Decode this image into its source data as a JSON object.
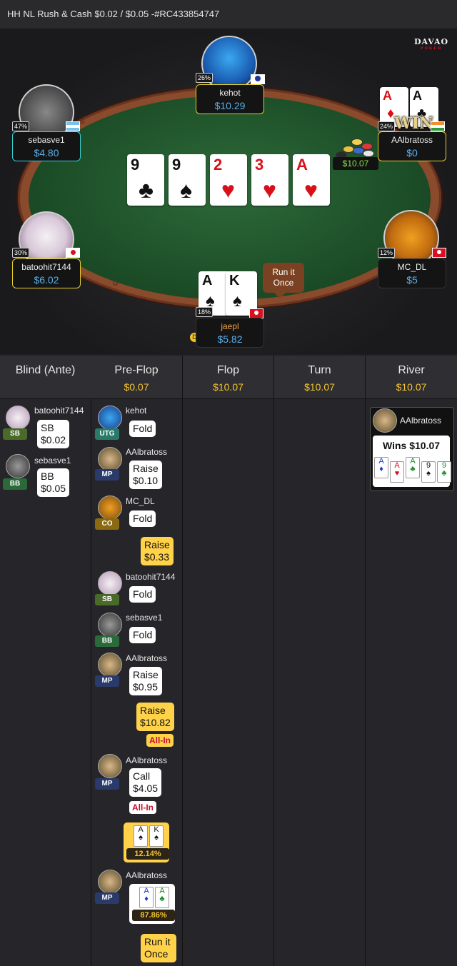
{
  "title": "HH NL Rush & Cash $0.02 / $0.05 -#RC433854747",
  "logo": {
    "brand": "DAVAO",
    "sub": "POKER"
  },
  "board": [
    {
      "rank": "9",
      "suit": "♣",
      "color": "#111111"
    },
    {
      "rank": "9",
      "suit": "♠",
      "color": "#111111"
    },
    {
      "rank": "2",
      "suit": "♥",
      "color": "#d8101a"
    },
    {
      "rank": "3",
      "suit": "♥",
      "color": "#d8101a"
    },
    {
      "rank": "A",
      "suit": "♥",
      "color": "#d8101a"
    }
  ],
  "pot": "$10.07",
  "win_label": "WIN",
  "run_it": "Run it Once",
  "dealer_label": "D",
  "players": {
    "kehot": {
      "name": "kehot",
      "stack": "$10.29",
      "equity": "26%"
    },
    "sebasve1": {
      "name": "sebasve1",
      "stack": "$4.80",
      "equity": "47%"
    },
    "aalbratoss": {
      "name": "AAlbratoss",
      "stack": "$0",
      "equity": "24%",
      "cards": [
        "A♦",
        "A♣"
      ]
    },
    "batoohit7144": {
      "name": "batoohit7144",
      "stack": "$6.02",
      "equity": "30%"
    },
    "mc_dl": {
      "name": "MC_DL",
      "stack": "$5",
      "equity": "12%"
    },
    "jaepl": {
      "name": "jaepl",
      "stack": "$5.82",
      "equity": "18%",
      "cards": [
        "A♠",
        "K♠"
      ]
    }
  },
  "history": {
    "columns": [
      {
        "label": "Blind (Ante)",
        "value": ""
      },
      {
        "label": "Pre-Flop",
        "value": "$0.07"
      },
      {
        "label": "Flop",
        "value": "$10.07"
      },
      {
        "label": "Turn",
        "value": "$10.07"
      },
      {
        "label": "River",
        "value": "$10.07"
      }
    ],
    "blinds": [
      {
        "name": "batoohit7144",
        "pos": "SB",
        "action": "SB",
        "amount": "$0.02"
      },
      {
        "name": "sebasve1",
        "pos": "BB",
        "action": "BB",
        "amount": "$0.05"
      }
    ],
    "preflop": [
      {
        "name": "kehot",
        "pos": "UTG",
        "action": "Fold"
      },
      {
        "name": "AAlbratoss",
        "pos": "MP",
        "action": "Raise",
        "amount": "$0.10"
      },
      {
        "name": "MC_DL",
        "pos": "CO",
        "action": "Fold"
      },
      {
        "hero_action": "Raise",
        "hero_amount": "$0.33"
      },
      {
        "name": "batoohit7144",
        "pos": "SB",
        "action": "Fold"
      },
      {
        "name": "sebasve1",
        "pos": "BB",
        "action": "Fold"
      },
      {
        "name": "AAlbratoss",
        "pos": "MP",
        "action": "Raise",
        "amount": "$0.95"
      },
      {
        "hero_action": "Raise",
        "hero_amount": "$10.82",
        "allin": "All-In"
      },
      {
        "name": "AAlbratoss",
        "pos": "MP",
        "action": "Call",
        "amount": "$4.05",
        "allin": "All-In"
      },
      {
        "hero_cards": [
          "A",
          "K"
        ],
        "hero_pct": "12.14%"
      },
      {
        "name": "AAlbratoss",
        "pos": "MP",
        "cards": [
          "A",
          "A"
        ],
        "pct": "87.86%"
      },
      {
        "hero_run": "Run it Once"
      }
    ],
    "river_winner": {
      "name": "AAlbratoss",
      "text": "Wins $10.07",
      "cards": [
        "A",
        "A",
        "A",
        "9",
        "9"
      ]
    }
  }
}
